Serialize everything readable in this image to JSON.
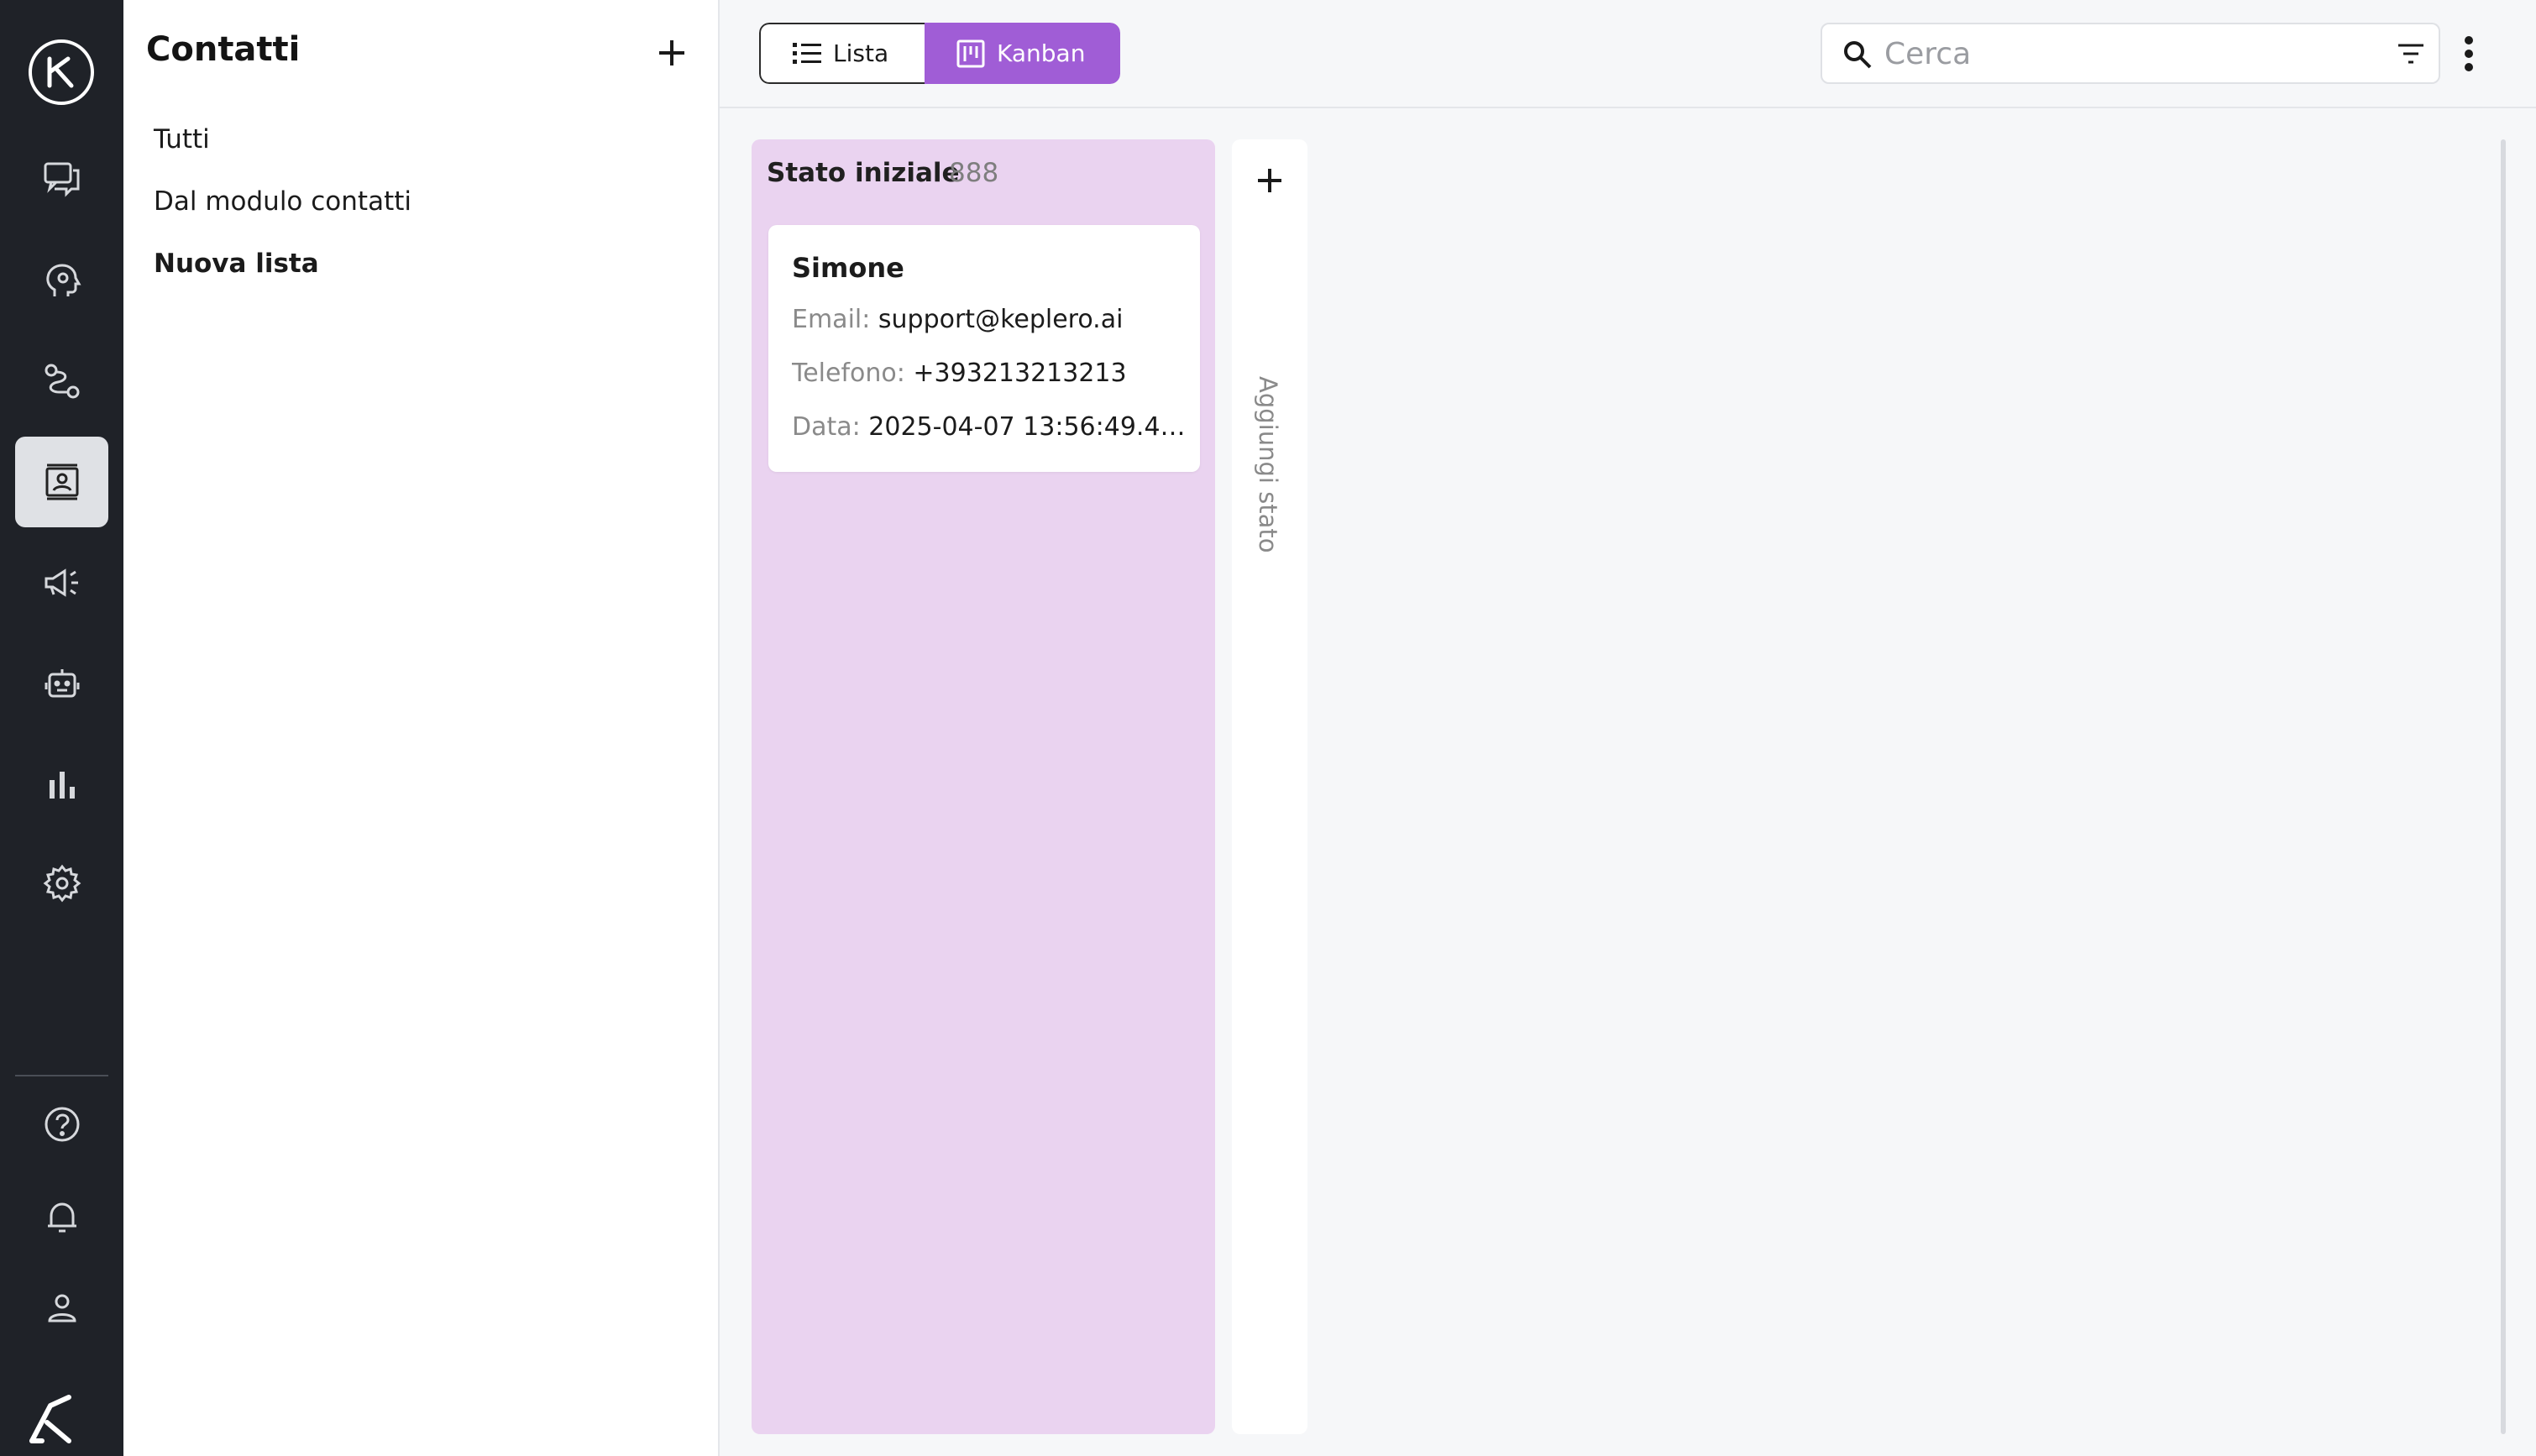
{
  "nav": {
    "items": [
      {
        "name": "chat-icon"
      },
      {
        "name": "brain-icon"
      },
      {
        "name": "flows-icon"
      },
      {
        "name": "contacts-icon",
        "active": true
      },
      {
        "name": "megaphone-icon"
      },
      {
        "name": "robot-icon"
      },
      {
        "name": "bar-chart-icon"
      },
      {
        "name": "gear-icon"
      },
      {
        "name": "help-icon"
      },
      {
        "name": "bell-icon"
      },
      {
        "name": "user-icon"
      }
    ]
  },
  "panel": {
    "title": "Contatti",
    "items": [
      "Tutti",
      "Dal modulo contatti",
      "Nuova lista"
    ]
  },
  "toolbar": {
    "lista_label": "Lista",
    "kanban_label": "Kanban",
    "search_placeholder": "Cerca"
  },
  "board": {
    "columns": [
      {
        "title": "Stato iniziale",
        "count": "888",
        "cards": [
          {
            "name": "Simone",
            "email_label": "Email:",
            "email": "support@keplero.ai",
            "phone_label": "Telefono:",
            "phone": "+393213213213",
            "date_label": "Data:",
            "date": "2025-04-07 13:56:49.4…"
          }
        ]
      }
    ],
    "add_column_label": "Aggiungi stato"
  },
  "colors": {
    "accent": "#a05dd6",
    "column_bg": "#ead3f0",
    "rail_bg": "#1f2228"
  }
}
